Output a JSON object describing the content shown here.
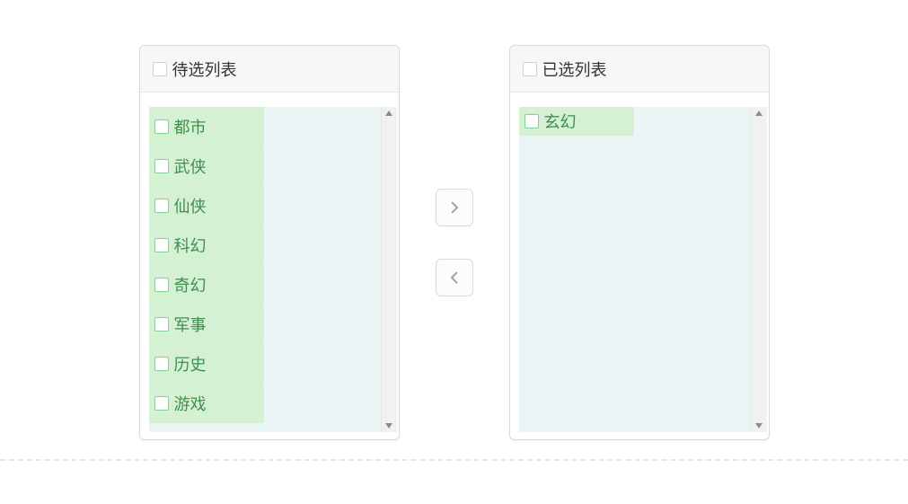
{
  "left": {
    "title": "待选列表",
    "items": [
      "都市",
      "武侠",
      "仙侠",
      "科幻",
      "奇幻",
      "军事",
      "历史",
      "游戏"
    ]
  },
  "right": {
    "title": "已选列表",
    "items": [
      "玄幻"
    ]
  }
}
